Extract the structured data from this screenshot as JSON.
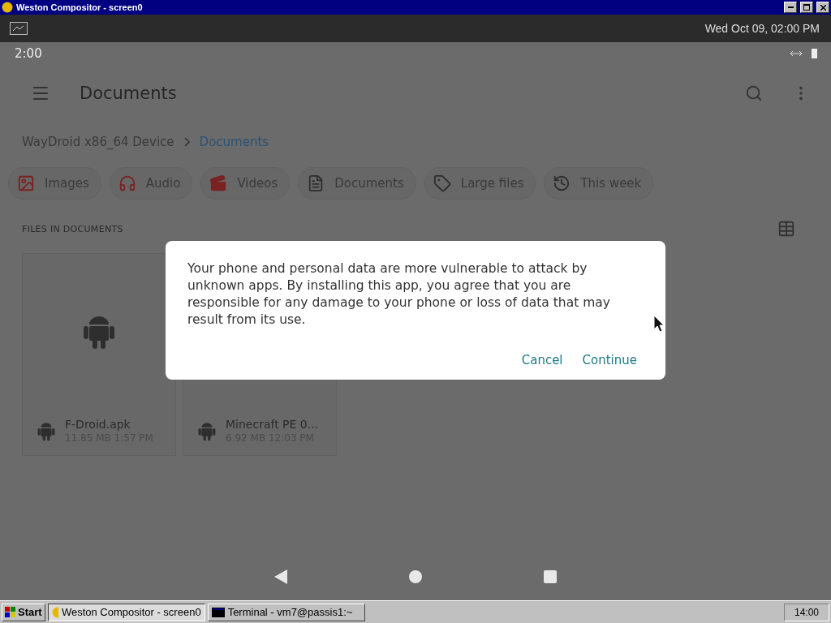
{
  "window": {
    "title": "Weston Compositor - screen0"
  },
  "panel": {
    "clock": "Wed Oct 09, 02:00 PM"
  },
  "status_bar": {
    "time": "2:00"
  },
  "toolbar": {
    "title": "Documents"
  },
  "breadcrumb": [
    {
      "label": "WayDroid x86_64 Device",
      "selected": false
    },
    {
      "label": "Documents",
      "selected": true
    }
  ],
  "chips": [
    {
      "label": "Images",
      "kind": "image"
    },
    {
      "label": "Audio",
      "kind": "audio"
    },
    {
      "label": "Videos",
      "kind": "video"
    },
    {
      "label": "Documents",
      "kind": "document"
    },
    {
      "label": "Large files",
      "kind": "tag"
    },
    {
      "label": "This week",
      "kind": "history"
    }
  ],
  "section": {
    "title": "FILES IN DOCUMENTS"
  },
  "files": [
    {
      "name": "F-Droid.apk",
      "details": "11.85 MB 1:57 PM",
      "kind": "preview"
    },
    {
      "name": "Minecraft PE 0...",
      "details": "6.92 MB 12:03 PM",
      "kind": "covered"
    }
  ],
  "dialog": {
    "message": "Your phone and personal data are more vulnerable to attack by unknown apps. By installing this app, you agree that you are responsible for any damage to your phone or loss of data that may result from its use.",
    "buttons": [
      "Cancel",
      "Continue"
    ]
  },
  "taskbar": {
    "start": "Start",
    "tasks": [
      {
        "label": "Weston Compositor - screen0",
        "selected": true,
        "kind": "weston"
      },
      {
        "label": "Terminal - vm7@passis1:~",
        "selected": false,
        "kind": "terminal"
      }
    ],
    "clock": "14:00"
  }
}
